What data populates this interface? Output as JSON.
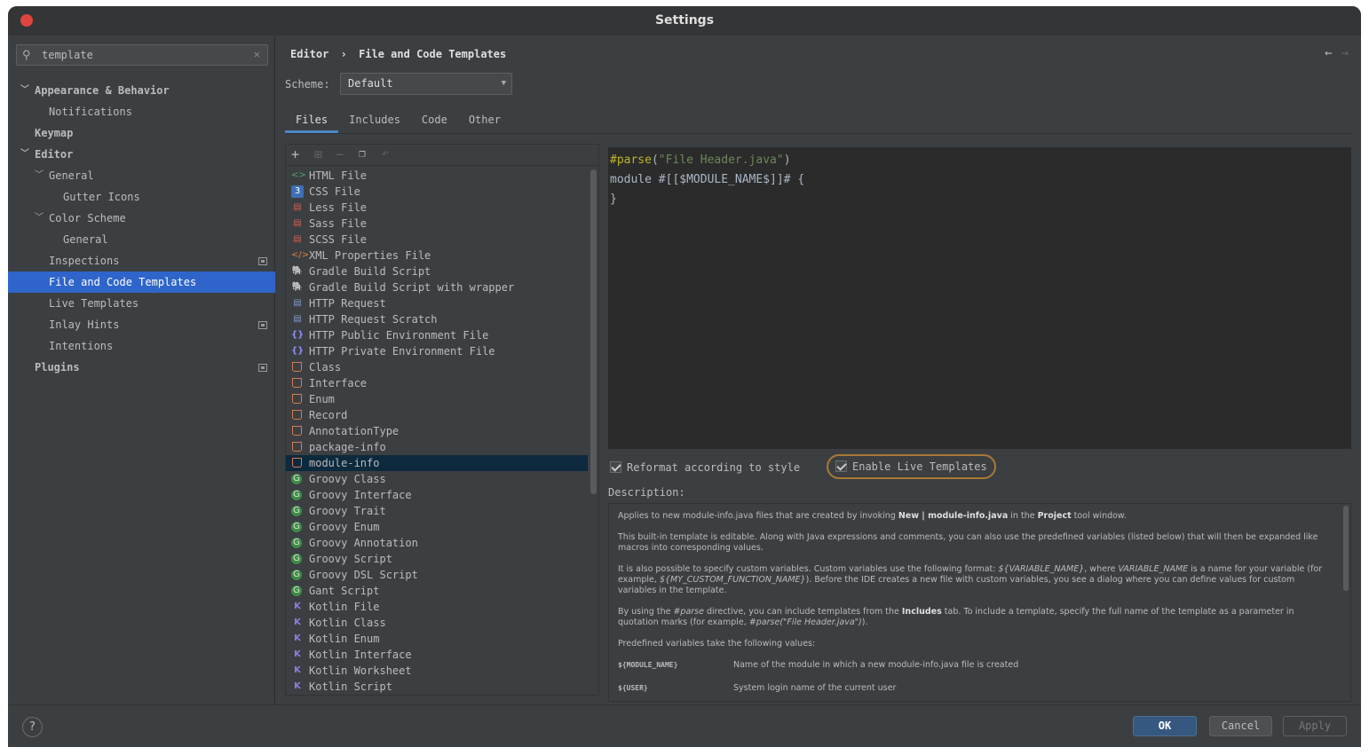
{
  "window": {
    "title": "Settings"
  },
  "search": {
    "value": "template",
    "clear": "✕"
  },
  "sidebar": {
    "items": [
      {
        "label": "Appearance & Behavior"
      },
      {
        "label": "Notifications"
      },
      {
        "label": "Keymap"
      },
      {
        "label": "Editor"
      },
      {
        "label": "General"
      },
      {
        "label": "Gutter Icons"
      },
      {
        "label": "Color Scheme"
      },
      {
        "label": "General"
      },
      {
        "label": "Inspections"
      },
      {
        "label": "File and Code Templates"
      },
      {
        "label": "Live Templates"
      },
      {
        "label": "Inlay Hints"
      },
      {
        "label": "Intentions"
      },
      {
        "label": "Plugins"
      }
    ]
  },
  "breadcrumb": {
    "parent": "Editor",
    "sep": "›",
    "current": "File and Code Templates"
  },
  "scheme": {
    "label": "Scheme:",
    "value": "Default"
  },
  "tabs": [
    {
      "label": "Files"
    },
    {
      "label": "Includes"
    },
    {
      "label": "Code"
    },
    {
      "label": "Other"
    }
  ],
  "templates": [
    {
      "label": "HTML File",
      "icon": "html-icon"
    },
    {
      "label": "CSS File",
      "icon": "css-icon"
    },
    {
      "label": "Less File",
      "icon": "less-icon"
    },
    {
      "label": "Sass File",
      "icon": "sass-icon"
    },
    {
      "label": "SCSS File",
      "icon": "scss-icon"
    },
    {
      "label": "XML Properties File",
      "icon": "xml-icon"
    },
    {
      "label": "Gradle Build Script",
      "icon": "gradle-icon"
    },
    {
      "label": "Gradle Build Script with wrapper",
      "icon": "gradle-icon"
    },
    {
      "label": "HTTP Request",
      "icon": "http-icon"
    },
    {
      "label": "HTTP Request Scratch",
      "icon": "http-icon"
    },
    {
      "label": "HTTP Public Environment File",
      "icon": "braces-icon"
    },
    {
      "label": "HTTP Private Environment File",
      "icon": "braces-icon"
    },
    {
      "label": "Class",
      "icon": "java-icon"
    },
    {
      "label": "Interface",
      "icon": "java-icon"
    },
    {
      "label": "Enum",
      "icon": "java-icon"
    },
    {
      "label": "Record",
      "icon": "java-icon"
    },
    {
      "label": "AnnotationType",
      "icon": "java-icon"
    },
    {
      "label": "package-info",
      "icon": "java-icon"
    },
    {
      "label": "module-info",
      "icon": "java-icon"
    },
    {
      "label": "Groovy Class",
      "icon": "groovy-icon"
    },
    {
      "label": "Groovy Interface",
      "icon": "groovy-icon"
    },
    {
      "label": "Groovy Trait",
      "icon": "groovy-icon"
    },
    {
      "label": "Groovy Enum",
      "icon": "groovy-icon"
    },
    {
      "label": "Groovy Annotation",
      "icon": "groovy-icon"
    },
    {
      "label": "Groovy Script",
      "icon": "groovy-icon"
    },
    {
      "label": "Groovy DSL Script",
      "icon": "groovy-icon"
    },
    {
      "label": "Gant Script",
      "icon": "groovy-icon"
    },
    {
      "label": "Kotlin File",
      "icon": "kotlin-icon"
    },
    {
      "label": "Kotlin Class",
      "icon": "kotlin-icon"
    },
    {
      "label": "Kotlin Enum",
      "icon": "kotlin-icon"
    },
    {
      "label": "Kotlin Interface",
      "icon": "kotlin-icon"
    },
    {
      "label": "Kotlin Worksheet",
      "icon": "kotlin-icon"
    },
    {
      "label": "Kotlin Script",
      "icon": "kotlin-icon"
    }
  ],
  "editor": {
    "line1_kw": "#parse",
    "line1_open": "(",
    "line1_str": "\"File Header.java\"",
    "line1_close": ")",
    "line2": "module #[[$MODULE_NAME$]]# {",
    "line3": "}"
  },
  "options": {
    "reformat": {
      "label": "Reformat according to style",
      "checked": true
    },
    "live": {
      "label": "Enable Live Templates",
      "checked": true
    }
  },
  "description": {
    "label": "Description:",
    "p1_a": "Applies to new module-info.java files that are created by invoking ",
    "p1_b": "New | module-info.java",
    "p1_c": " in the ",
    "p1_d": "Project",
    "p1_e": " tool window.",
    "p2": "This built-in template is editable. Along with Java expressions and comments, you can also use the predefined variables (listed below) that will then be expanded like macros into corresponding values.",
    "p3_a": "It is also possible to specify custom variables. Custom variables use the following format: ",
    "p3_b": "${VARIABLE_NAME}",
    "p3_c": ", where ",
    "p3_d": "VARIABLE_NAME",
    "p3_e": " is a name for your variable (for example, ",
    "p3_f": "${MY_CUSTOM_FUNCTION_NAME}",
    "p3_g": "). Before the IDE creates a new file with custom variables, you see a dialog where you can define values for custom variables in the template.",
    "p4_a": "By using the ",
    "p4_b": "#parse",
    "p4_c": " directive, you can include templates from the ",
    "p4_d": "Includes",
    "p4_e": " tab. To include a template, specify the full name of the template as a parameter in quotation marks (for example, ",
    "p4_f": "#parse(\"File Header.java\")",
    "p4_g": ").",
    "p5": "Predefined variables take the following values:",
    "vars": [
      {
        "name": "${MODULE_NAME}",
        "desc": "Name of the module in which a new module-info.java file is created"
      },
      {
        "name": "${USER}",
        "desc": "System login name of the current user"
      }
    ]
  },
  "footer": {
    "help": "?",
    "ok": "OK",
    "cancel": "Cancel",
    "apply": "Apply"
  },
  "colors": {
    "accent": "#2f65ca",
    "ok_button": "#365880",
    "highlight_border": "#a77a36",
    "close_button": "#e0443e"
  }
}
